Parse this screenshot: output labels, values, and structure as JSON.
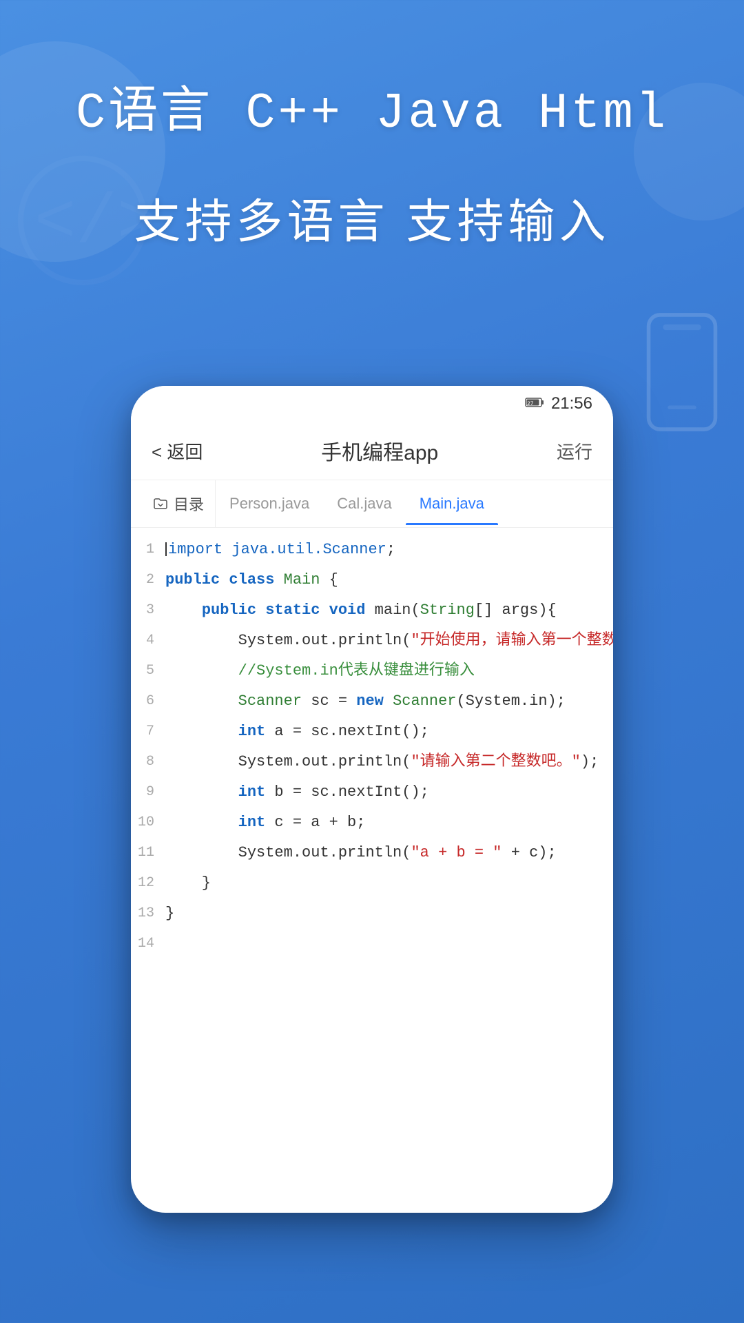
{
  "background": {
    "gradient_start": "#4a90e2",
    "gradient_end": "#2e6fc4"
  },
  "header": {
    "lang_title": "C语言  C++  Java  Html",
    "subtitle": "支持多语言  支持输入"
  },
  "phone": {
    "status_bar": {
      "battery": "27",
      "time": "21:56"
    },
    "nav": {
      "back_label": "< 返回",
      "title": "手机编程app",
      "run_label": "运行"
    },
    "tabs": [
      {
        "id": "folder",
        "label": "目录",
        "icon": "folder-icon",
        "active": false
      },
      {
        "id": "person-java",
        "label": "Person.java",
        "active": false
      },
      {
        "id": "cal-java",
        "label": "Cal.java",
        "active": false
      },
      {
        "id": "main-java",
        "label": "Main.java",
        "active": true
      }
    ],
    "code": {
      "lines": [
        {
          "num": 1,
          "content": "import java.util.Scanner;"
        },
        {
          "num": 2,
          "content": "public class Main {"
        },
        {
          "num": 3,
          "content": "    public static void main(String[] args){"
        },
        {
          "num": 4,
          "content": "        System.out.println(\"开始使用，请输入第一个整数吧。\");"
        },
        {
          "num": 5,
          "content": "        //System.in代表从键盘进行输入"
        },
        {
          "num": 6,
          "content": "        Scanner sc = new Scanner(System.in);"
        },
        {
          "num": 7,
          "content": "        int a = sc.nextInt();"
        },
        {
          "num": 8,
          "content": "        System.out.println(\"请输入第二个整数吧。\");"
        },
        {
          "num": 9,
          "content": "        int b = sc.nextInt();"
        },
        {
          "num": 10,
          "content": "        int c = a + b;"
        },
        {
          "num": 11,
          "content": "        System.out.println(\"a + b = \" + c);"
        },
        {
          "num": 12,
          "content": "    }"
        },
        {
          "num": 13,
          "content": "}"
        },
        {
          "num": 14,
          "content": ""
        }
      ]
    }
  }
}
